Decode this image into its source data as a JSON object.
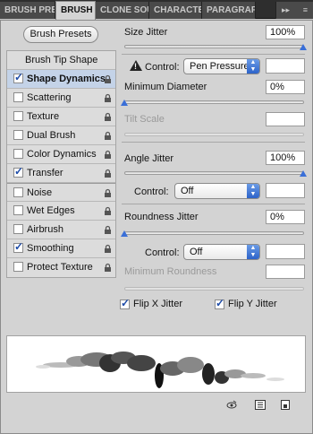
{
  "tabs": [
    {
      "label": "BRUSH PRE"
    },
    {
      "label": "BRUSH"
    },
    {
      "label": "CLONE SOU"
    },
    {
      "label": "CHARACTE"
    },
    {
      "label": "PARAGRAPH"
    }
  ],
  "tab_menu": "▸▸",
  "brush_presets_button": "Brush Presets",
  "left_list": [
    {
      "label": "Brush Tip Shape",
      "checked": null
    },
    {
      "label": "Shape Dynamics",
      "checked": true
    },
    {
      "label": "Scattering",
      "checked": false
    },
    {
      "label": "Texture",
      "checked": false
    },
    {
      "label": "Dual Brush",
      "checked": false
    },
    {
      "label": "Color Dynamics",
      "checked": false
    },
    {
      "label": "Transfer",
      "checked": true
    },
    {
      "label": "Noise",
      "checked": false
    },
    {
      "label": "Wet Edges",
      "checked": false
    },
    {
      "label": "Airbrush",
      "checked": false
    },
    {
      "label": "Smoothing",
      "checked": true
    },
    {
      "label": "Protect Texture",
      "checked": false
    }
  ],
  "size_jitter": {
    "label": "Size Jitter",
    "value": "100%",
    "level": 1.0
  },
  "size_control": {
    "label": "Control:",
    "selected": "Pen Pressure",
    "value": ""
  },
  "minimum_diameter": {
    "label": "Minimum Diameter",
    "value": "0%",
    "level": 0.0
  },
  "tilt_scale": {
    "label": "Tilt Scale",
    "value": ""
  },
  "angle_jitter": {
    "label": "Angle Jitter",
    "value": "100%",
    "level": 1.0
  },
  "angle_control": {
    "label": "Control:",
    "selected": "Off",
    "value": ""
  },
  "roundness_jitter": {
    "label": "Roundness Jitter",
    "value": "0%",
    "level": 0.0
  },
  "roundness_control": {
    "label": "Control:",
    "selected": "Off",
    "value": ""
  },
  "minimum_roundness": {
    "label": "Minimum Roundness",
    "value": ""
  },
  "flip_x": {
    "label": "Flip X Jitter",
    "checked": true
  },
  "flip_y": {
    "label": "Flip Y Jitter",
    "checked": true
  },
  "icons": {
    "warning": "warning-icon",
    "lock": "lock-icon",
    "eye": "toggle-live-tip-preview-icon",
    "grid": "brush-editor-grid-icon",
    "new": "create-new-brush-icon"
  },
  "colors": {
    "accent": "#3a6fd8",
    "selected_row": "#c4d3e8",
    "tab_bg": "#2e2e2e"
  }
}
